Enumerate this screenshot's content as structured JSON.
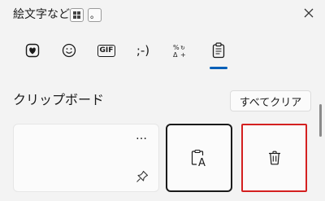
{
  "header": {
    "title": "絵文字など",
    "keycap_win_icon": "windows-key-icon",
    "keycap_period": "。",
    "close_icon": "close-icon"
  },
  "tabs": [
    {
      "name": "emoji-favorites",
      "icon": "heart-emoji-icon",
      "selected": false
    },
    {
      "name": "smiley",
      "icon": "smiley-icon",
      "selected": false
    },
    {
      "name": "gif",
      "label": "GIF",
      "selected": false
    },
    {
      "name": "kaomoji",
      "label": ";-)",
      "selected": false
    },
    {
      "name": "symbols",
      "icon": "symbols-icon",
      "selected": false
    },
    {
      "name": "clipboard",
      "icon": "clipboard-icon",
      "selected": true
    }
  ],
  "clipboard": {
    "section_title": "クリップボード",
    "clear_all_label": "すべてクリア",
    "more_label": "…"
  },
  "colors": {
    "accent": "#005fb8",
    "highlight_border": "#d42020",
    "background": "#f3f3f3"
  }
}
